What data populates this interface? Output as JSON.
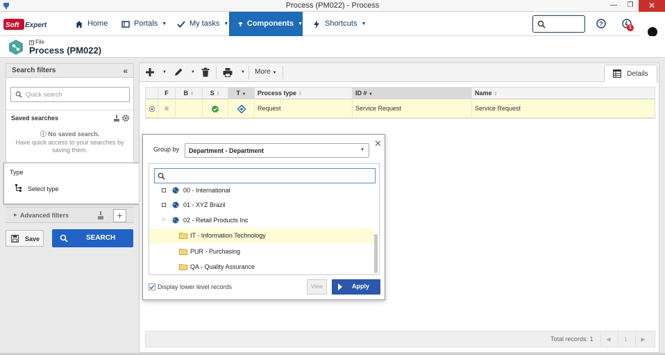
{
  "window": {
    "title": "Process (PM022) - Process"
  },
  "nav": {
    "logo": "Soft Expert",
    "home": "Home",
    "portals": "Portals",
    "mytasks": "My tasks",
    "components": "Components",
    "shortcuts": "Shortcuts",
    "notification_count": "1"
  },
  "header": {
    "subtitle": "File",
    "title": "Process (PM022)"
  },
  "filters": {
    "title": "Search filters",
    "quick_search_placeholder": "Quick search",
    "saved_searches": "Saved searches",
    "no_saved": "No saved search.",
    "no_saved_hint": "Have quick access to your searches by saving them.",
    "type_label": "Type",
    "select_type": "Select type",
    "advanced": "Advanced filters",
    "save": "Save",
    "search": "SEARCH"
  },
  "toolbar": {
    "more": "More",
    "details": "Details"
  },
  "grid": {
    "columns": [
      "F",
      "B",
      "S",
      "T",
      "Process type",
      "ID #",
      "Name"
    ],
    "row": {
      "process_type": "Request",
      "id": "Service Request",
      "name": "Service Request"
    },
    "total": "Total records: 1",
    "page": "1"
  },
  "popup": {
    "group_by_label": "Group by",
    "group_by_value": "Department - Department",
    "tree": [
      {
        "label": "00 - International",
        "kind": "globe"
      },
      {
        "label": "01 - XYZ Brazil",
        "kind": "globe"
      },
      {
        "label": "02 - Retail Products Inc",
        "kind": "globe"
      },
      {
        "label": "IT - Information Technology",
        "kind": "folder"
      },
      {
        "label": "PUR - Purchasing",
        "kind": "folder"
      },
      {
        "label": "QA - Quality Assurance",
        "kind": "folder"
      }
    ],
    "display_lower": "Display lower level records",
    "view": "View",
    "apply": "Apply"
  },
  "colors": {
    "accent": "#1e6bb8",
    "search_button": "#2162c4",
    "apply_button": "#2b57ad",
    "highlight": "#fdfcd6",
    "badge": "#d9232b"
  }
}
